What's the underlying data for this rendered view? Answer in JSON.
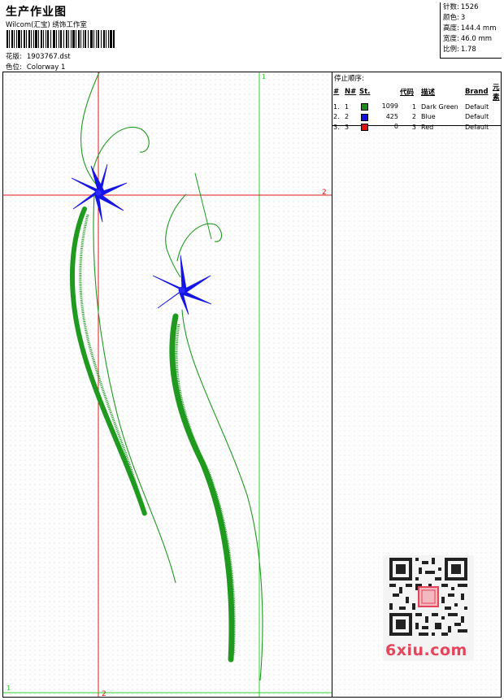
{
  "header": {
    "title": "生产作业图",
    "company": "Wilcom(汇宝) 绣饰工作室",
    "design_label": "花版:",
    "design_value": "1903767.dst",
    "colorway_label": "色位:",
    "colorway_value": "Colorway 1"
  },
  "stats": [
    {
      "label": "针数:",
      "value": "1526"
    },
    {
      "label": "颜色:",
      "value": "3"
    },
    {
      "label": "高度:",
      "value": "144.4 mm"
    },
    {
      "label": "宽度:",
      "value": "46.0 mm"
    },
    {
      "label": "比例:",
      "value": "1.78"
    }
  ],
  "stop_sequence": {
    "title": "停止顺序:",
    "columns": [
      "#",
      "N#",
      "St.",
      "代码",
      "描述",
      "Brand",
      "元素"
    ],
    "rows": [
      {
        "idx": "1.",
        "n": "1",
        "stitches": "1099",
        "code": "1",
        "desc": "Dark Green",
        "brand": "Default",
        "color": "#1a8a1a"
      },
      {
        "idx": "2.",
        "n": "2",
        "stitches": "425",
        "code": "2",
        "desc": "Blue",
        "brand": "Default",
        "color": "#1010e0"
      },
      {
        "idx": "3.",
        "n": "3",
        "stitches": "0",
        "code": "3",
        "desc": "Red",
        "brand": "Default",
        "color": "#e01010"
      }
    ]
  },
  "guides": {
    "vertical_1_label": "1",
    "vertical_2_label": "2",
    "horizontal_2_label": "2",
    "horizontal_1_label": "1"
  },
  "colors": {
    "thread_green": "#1f9a1f",
    "thread_blue": "#1414e6",
    "guide_red": "#e01a1a",
    "guide_green": "#2ad42a"
  },
  "watermark": {
    "text": "6xiu.com"
  }
}
